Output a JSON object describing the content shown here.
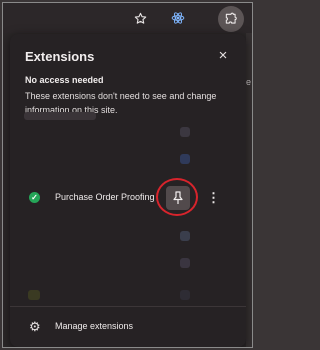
{
  "toolbar": {
    "icons": [
      "star-icon",
      "atom-icon",
      "puzzle-icon"
    ]
  },
  "popup": {
    "title": "Extensions",
    "close_icon": "×",
    "section_heading": "No access needed",
    "section_description": "These extensions don't need to see and change information on this site.",
    "extension": {
      "name": "Purchase Order Proofing",
      "status_icon": "✓",
      "more_icon": "⋮"
    },
    "manage_label": "Manage extensions",
    "manage_icon": "⚙"
  },
  "colors": {
    "accent_highlight": "#d8242c",
    "enabled_check": "#25a558",
    "popup_bg": "#262224"
  }
}
